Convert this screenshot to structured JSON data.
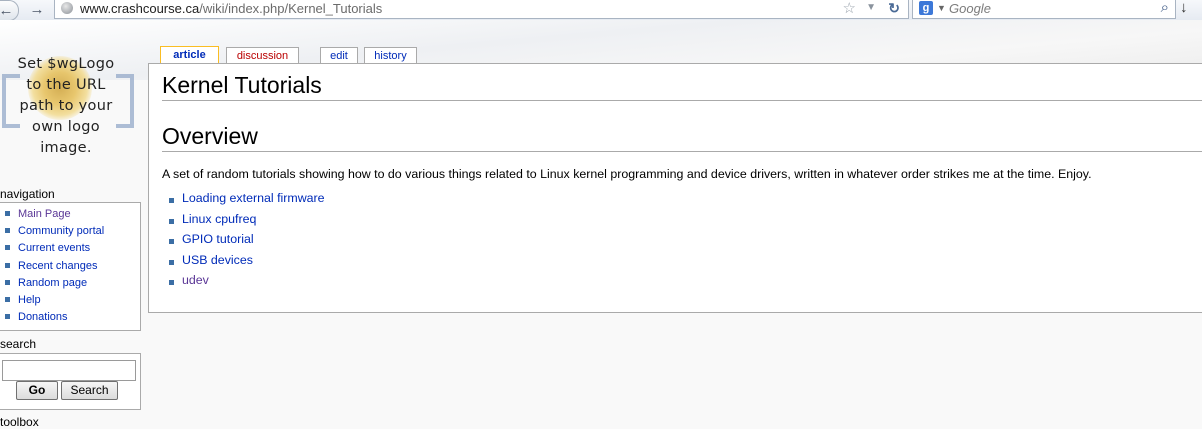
{
  "browser": {
    "url_host": "www.crashcourse.ca",
    "url_path": "/wiki/index.php/Kernel_Tutorials",
    "search_placeholder": "Google",
    "icons": [
      "back-icon",
      "forward-icon",
      "globe-icon",
      "bookmark-star-icon",
      "dropdown-icon",
      "reload-icon",
      "google-icon",
      "magnifier-icon",
      "download-icon"
    ]
  },
  "logo": {
    "text": "Set $wgLogo to the URL path to your own logo image."
  },
  "tabs": [
    {
      "label": "article"
    },
    {
      "label": "discussion"
    },
    {
      "label": "edit"
    },
    {
      "label": "history"
    }
  ],
  "page": {
    "title": "Kernel Tutorials",
    "section_heading": "Overview",
    "intro": "A set of random tutorials showing how to do various things related to Linux kernel programming and device drivers, written in whatever order strikes me at the time. Enjoy.",
    "links": [
      {
        "label": "Loading external firmware"
      },
      {
        "label": "Linux cpufreq"
      },
      {
        "label": "GPIO tutorial"
      },
      {
        "label": "USB devices"
      },
      {
        "label": "udev"
      }
    ]
  },
  "sidebar": {
    "navigation_heading": "navigation",
    "nav_items": [
      {
        "label": "Main Page"
      },
      {
        "label": "Community portal"
      },
      {
        "label": "Current events"
      },
      {
        "label": "Recent changes"
      },
      {
        "label": "Random page"
      },
      {
        "label": "Help"
      },
      {
        "label": "Donations"
      }
    ],
    "search_heading": "search",
    "go_label": "Go",
    "search_label": "Search",
    "toolbox_heading": "toolbox"
  }
}
